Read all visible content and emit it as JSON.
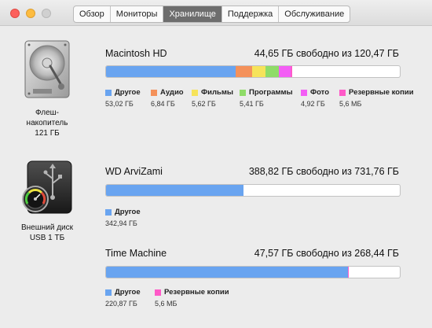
{
  "tabs": [
    {
      "label": "Обзор"
    },
    {
      "label": "Мониторы"
    },
    {
      "label": "Хранилище",
      "active": true
    },
    {
      "label": "Поддержка"
    },
    {
      "label": "Обслуживание"
    }
  ],
  "drives": [
    {
      "icon": "internal-hdd-icon",
      "label_lines": [
        "Флеш-",
        "накопитель",
        "121 ГБ"
      ],
      "name": "Macintosh HD",
      "free_text": "44,65 ГБ свободно из 120,47 ГБ",
      "total_gb": 120.47,
      "segments": [
        {
          "name": "Другое",
          "size": "53,02 ГБ",
          "gb": 53.02,
          "color": "#69a4f0"
        },
        {
          "name": "Аудио",
          "size": "6,84 ГБ",
          "gb": 6.84,
          "color": "#f4915a"
        },
        {
          "name": "Фильмы",
          "size": "5,62 ГБ",
          "gb": 5.62,
          "color": "#f6e35a"
        },
        {
          "name": "Программы",
          "size": "5,41 ГБ",
          "gb": 5.41,
          "color": "#8fdc68"
        },
        {
          "name": "Фото",
          "size": "4,92 ГБ",
          "gb": 4.92,
          "color": "#f35ef5"
        },
        {
          "name": "Резервные копии",
          "size": "5,6 МБ",
          "gb": 0.0056,
          "color": "#ff5ac8"
        }
      ]
    },
    {
      "icon": "external-usb-drive-icon",
      "label_lines": [
        "Внешний диск",
        "USB 1 ТБ"
      ],
      "name": "WD ArviZami",
      "free_text": "388,82 ГБ свободно из 731,76 ГБ",
      "total_gb": 731.76,
      "segments": [
        {
          "name": "Другое",
          "size": "342,94 ГБ",
          "gb": 342.94,
          "color": "#69a4f0"
        }
      ]
    },
    {
      "name": "Time Machine",
      "free_text": "47,57 ГБ свободно из 268,44 ГБ",
      "total_gb": 268.44,
      "segments": [
        {
          "name": "Другое",
          "size": "220,87 ГБ",
          "gb": 220.87,
          "color": "#69a4f0"
        },
        {
          "name": "Резервные копии",
          "size": "5,6 МБ",
          "gb": 0.0056,
          "color": "#ff5ac8"
        }
      ]
    }
  ]
}
